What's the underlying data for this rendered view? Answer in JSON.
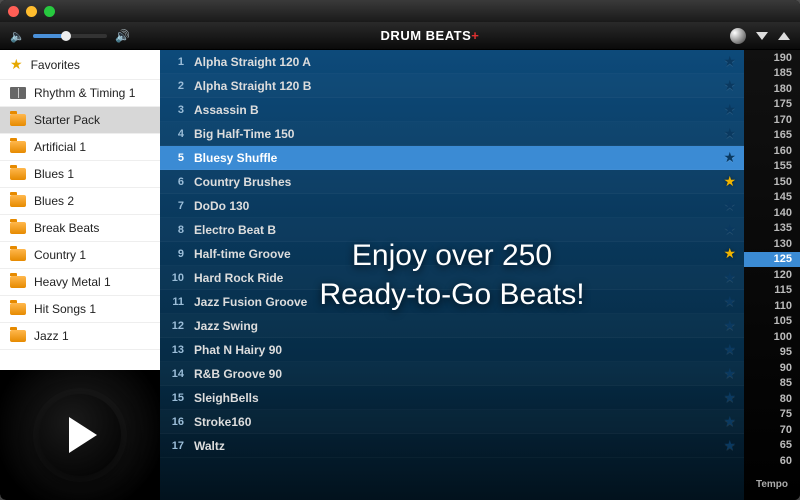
{
  "app": {
    "title": "DRUM BEATS",
    "title_suffix": "+"
  },
  "overlay": {
    "line1": "Enjoy over 250",
    "line2": "Ready-to-Go Beats!"
  },
  "sidebar": {
    "categories": [
      {
        "label": "Favorites",
        "icon": "star",
        "selected": false
      },
      {
        "label": "Rhythm & Timing 1",
        "icon": "book",
        "selected": false
      },
      {
        "label": "Starter Pack",
        "icon": "folder",
        "selected": true
      },
      {
        "label": "Artificial 1",
        "icon": "folder",
        "selected": false
      },
      {
        "label": "Blues 1",
        "icon": "folder",
        "selected": false
      },
      {
        "label": "Blues 2",
        "icon": "folder",
        "selected": false
      },
      {
        "label": "Break Beats",
        "icon": "folder",
        "selected": false
      },
      {
        "label": "Country 1",
        "icon": "folder",
        "selected": false
      },
      {
        "label": "Heavy Metal 1",
        "icon": "folder",
        "selected": false
      },
      {
        "label": "Hit Songs 1",
        "icon": "folder",
        "selected": false
      },
      {
        "label": "Jazz 1",
        "icon": "folder",
        "selected": false
      }
    ]
  },
  "beats": [
    {
      "n": 1,
      "name": "Alpha Straight 120 A",
      "fav": false,
      "selected": false
    },
    {
      "n": 2,
      "name": "Alpha Straight 120 B",
      "fav": false,
      "selected": false
    },
    {
      "n": 3,
      "name": "Assassin B",
      "fav": false,
      "selected": false
    },
    {
      "n": 4,
      "name": "Big Half-Time 150",
      "fav": false,
      "selected": false
    },
    {
      "n": 5,
      "name": "Bluesy Shuffle",
      "fav": false,
      "selected": true
    },
    {
      "n": 6,
      "name": "Country Brushes",
      "fav": true,
      "selected": false
    },
    {
      "n": 7,
      "name": "DoDo 130",
      "fav": false,
      "selected": false
    },
    {
      "n": 8,
      "name": "Electro Beat B",
      "fav": false,
      "selected": false
    },
    {
      "n": 9,
      "name": "Half-time Groove",
      "fav": true,
      "selected": false
    },
    {
      "n": 10,
      "name": "Hard Rock Ride",
      "fav": false,
      "selected": false
    },
    {
      "n": 11,
      "name": "Jazz Fusion Groove",
      "fav": false,
      "selected": false
    },
    {
      "n": 12,
      "name": "Jazz Swing",
      "fav": false,
      "selected": false
    },
    {
      "n": 13,
      "name": "Phat N Hairy 90",
      "fav": false,
      "selected": false
    },
    {
      "n": 14,
      "name": "R&B Groove 90",
      "fav": false,
      "selected": false
    },
    {
      "n": 15,
      "name": "SleighBells",
      "fav": false,
      "selected": false
    },
    {
      "n": 16,
      "name": "Stroke160",
      "fav": false,
      "selected": false
    },
    {
      "n": 17,
      "name": "Waltz",
      "fav": false,
      "selected": false
    }
  ],
  "tempo": {
    "label": "Tempo",
    "values": [
      190,
      185,
      180,
      175,
      170,
      165,
      160,
      155,
      150,
      145,
      140,
      135,
      130,
      125,
      120,
      115,
      110,
      105,
      100,
      95,
      90,
      85,
      80,
      75,
      70,
      65,
      60
    ],
    "selected": 125
  }
}
